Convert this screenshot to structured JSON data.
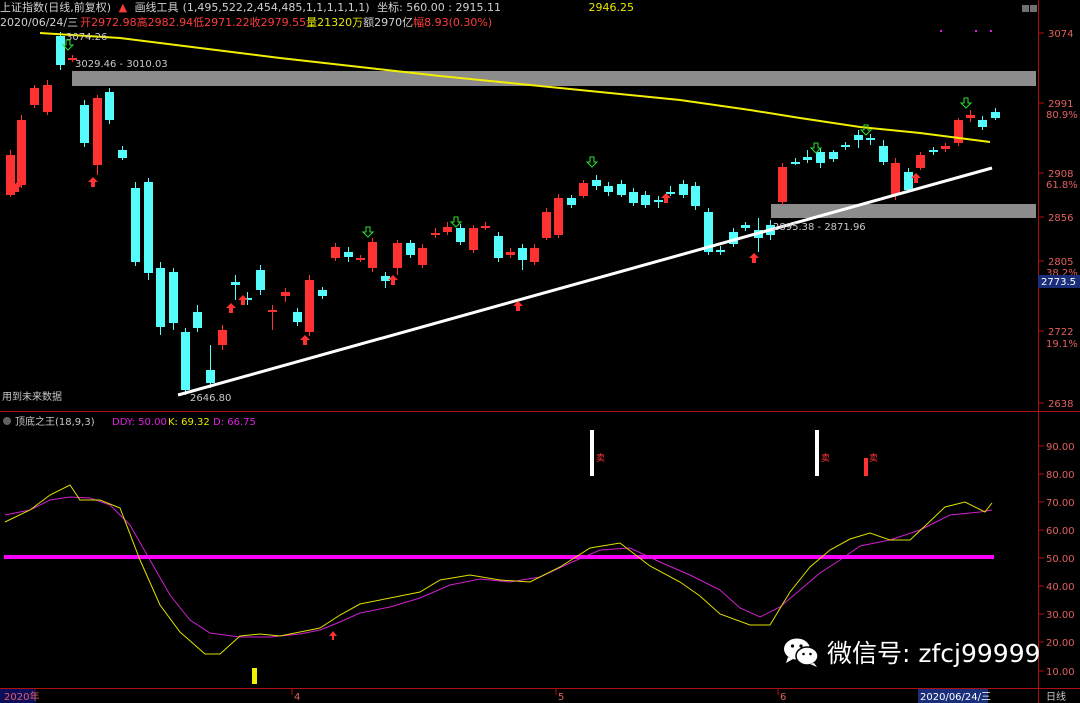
{
  "header": {
    "index_name": "上证指数(日线,前复权)",
    "tool_label": "画线工具",
    "tool_params": "(1,495,522,2,454,485,1,1,1,1,1,1)",
    "coord_label": "坐标: 560.00 : 2915.11",
    "right_value": "2946.25"
  },
  "infobar": {
    "date": "2020/06/24/三",
    "open": "开2972.98",
    "high": "高2982.94",
    "low": "低2971.22",
    "close": "收2979.55",
    "volume": "量21320万",
    "amount": "额2970亿",
    "change": "幅8.93(0.30%)"
  },
  "main_chart": {
    "price_ticks": [
      "3074",
      "2991",
      "2908",
      "2856",
      "2805",
      "2722",
      "2638"
    ],
    "fib_labels": [
      "80.9%",
      "61.8%",
      "38.2%",
      "19.1%"
    ],
    "current_price_tag": "2773.5",
    "annotations": {
      "peak": "3074.26",
      "box_top": "3029.46 - 3010.03",
      "box_bottom": "2895.38 - 2871.96",
      "low": "2646.80",
      "future_data": "用到未来数据"
    },
    "colors": {
      "up": "#ff3232",
      "down": "#54fcfc",
      "ma": "#f0f000",
      "trend": "#ffffff",
      "box": "#8c8c8c"
    }
  },
  "indicator": {
    "title": "顶底之王(18,9,3)",
    "ddy": "DDY: 50.00",
    "k": "K: 69.32",
    "d": "D: 66.75",
    "ticks": [
      "90.00",
      "80.00",
      "70.00",
      "60.00",
      "50.00",
      "40.00",
      "30.00",
      "20.00",
      "10.00"
    ],
    "sell_label": "卖",
    "colors": {
      "k": "#e0e000",
      "d": "#d020d0",
      "ddy": "#ff00ff"
    }
  },
  "xaxis": {
    "labels": [
      "2020年",
      "4",
      "5",
      "6"
    ],
    "current_date": "2020/06/24/三",
    "period": "日线"
  },
  "watermark": "微信号: zfcj99999"
}
